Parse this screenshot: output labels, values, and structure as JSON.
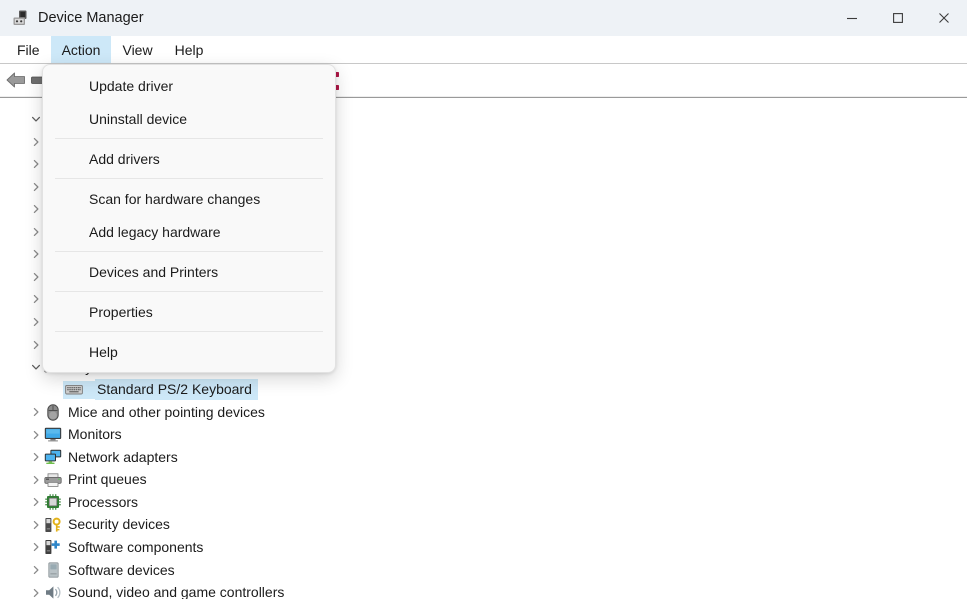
{
  "window": {
    "title": "Device Manager",
    "icon": "device-manager-icon",
    "controls": {
      "minimize": "─",
      "maximize": "□",
      "close": "✕"
    },
    "colors": {
      "titlebar_bg": "#eef2f6",
      "accent_highlight": "#cde8f8",
      "menu_bg": "#f9f9f9",
      "text": "#1b1b1b"
    }
  },
  "menubar": {
    "items": [
      {
        "label": "File",
        "active": false
      },
      {
        "label": "Action",
        "active": true
      },
      {
        "label": "View",
        "active": false
      },
      {
        "label": "Help",
        "active": false
      }
    ]
  },
  "toolbar": {
    "buttons": [
      {
        "name": "back-arrow-icon"
      },
      {
        "name": "toolbar-list-icon"
      },
      {
        "name": "toolbar-scan-icon"
      }
    ]
  },
  "action_menu": {
    "open": true,
    "groups": [
      {
        "items": [
          {
            "label": "Update driver"
          },
          {
            "label": "Uninstall device"
          }
        ]
      },
      {
        "items": [
          {
            "label": "Add drivers"
          }
        ]
      },
      {
        "items": [
          {
            "label": "Scan for hardware changes"
          },
          {
            "label": "Add legacy hardware"
          }
        ]
      },
      {
        "items": [
          {
            "label": "Devices and Printers"
          }
        ]
      },
      {
        "items": [
          {
            "label": "Properties"
          }
        ]
      },
      {
        "items": [
          {
            "label": "Help"
          }
        ]
      }
    ]
  },
  "tree": {
    "rows": [
      {
        "label": "",
        "icon": "computer-icon",
        "indent": 0,
        "state": "expanded",
        "selected": false,
        "occluded": true
      },
      {
        "label": "",
        "icon": "",
        "indent": 1,
        "state": "collapsed",
        "selected": false,
        "occluded": true
      },
      {
        "label": "",
        "icon": "",
        "indent": 1,
        "state": "collapsed",
        "selected": false,
        "occluded": true
      },
      {
        "label": "",
        "icon": "",
        "indent": 1,
        "state": "collapsed",
        "selected": false,
        "occluded": true
      },
      {
        "label": "",
        "icon": "",
        "indent": 1,
        "state": "collapsed",
        "selected": false,
        "occluded": true
      },
      {
        "label": "",
        "icon": "",
        "indent": 1,
        "state": "collapsed",
        "selected": false,
        "occluded": true
      },
      {
        "label": "",
        "icon": "",
        "indent": 1,
        "state": "collapsed",
        "selected": false,
        "occluded": true
      },
      {
        "label": "",
        "icon": "",
        "indent": 1,
        "state": "collapsed",
        "selected": false,
        "occluded": true
      },
      {
        "label": "",
        "icon": "",
        "indent": 1,
        "state": "collapsed",
        "selected": false,
        "occluded": true
      },
      {
        "label": "",
        "icon": "",
        "indent": 1,
        "state": "collapsed",
        "selected": false,
        "occluded": true
      },
      {
        "label": "",
        "icon": "",
        "indent": 1,
        "state": "collapsed",
        "selected": false,
        "occluded": true
      },
      {
        "label": "Keyboards",
        "icon": "keyboard-icon",
        "indent": 1,
        "state": "expanded",
        "selected": false,
        "occluded": false
      },
      {
        "label": "Standard PS/2 Keyboard",
        "icon": "keyboard-icon",
        "indent": 2,
        "state": "leaf",
        "selected": true,
        "occluded": false
      },
      {
        "label": "Mice and other pointing devices",
        "icon": "mouse-icon",
        "indent": 1,
        "state": "collapsed",
        "selected": false,
        "occluded": false
      },
      {
        "label": "Monitors",
        "icon": "monitor-icon",
        "indent": 1,
        "state": "collapsed",
        "selected": false,
        "occluded": false
      },
      {
        "label": "Network adapters",
        "icon": "network-adapter-icon",
        "indent": 1,
        "state": "collapsed",
        "selected": false,
        "occluded": false
      },
      {
        "label": "Print queues",
        "icon": "printer-icon",
        "indent": 1,
        "state": "collapsed",
        "selected": false,
        "occluded": false
      },
      {
        "label": "Processors",
        "icon": "processor-icon",
        "indent": 1,
        "state": "collapsed",
        "selected": false,
        "occluded": false
      },
      {
        "label": "Security devices",
        "icon": "security-device-icon",
        "indent": 1,
        "state": "collapsed",
        "selected": false,
        "occluded": false
      },
      {
        "label": "Software components",
        "icon": "software-component-icon",
        "indent": 1,
        "state": "collapsed",
        "selected": false,
        "occluded": false
      },
      {
        "label": "Software devices",
        "icon": "software-device-icon",
        "indent": 1,
        "state": "collapsed",
        "selected": false,
        "occluded": false
      },
      {
        "label": "Sound, video and game controllers",
        "icon": "sound-controller-icon",
        "indent": 1,
        "state": "collapsed",
        "selected": false,
        "occluded": false
      }
    ]
  }
}
